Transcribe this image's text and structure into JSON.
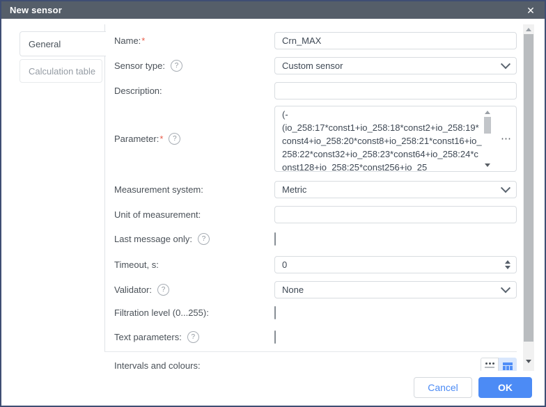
{
  "window": {
    "title": "New sensor"
  },
  "icons": {
    "close": "✕",
    "help": "?",
    "required": "*",
    "param_more": "⋯"
  },
  "tabs": {
    "general": "General",
    "calculation": "Calculation table"
  },
  "form": {
    "name": {
      "label": "Name:",
      "required": true,
      "value": "Crn_MAX"
    },
    "sensor_type": {
      "label": "Sensor type:",
      "value": "Custom sensor"
    },
    "description": {
      "label": "Description:",
      "value": ""
    },
    "parameter": {
      "label": "Parameter:",
      "required": true,
      "value": "(-\n(io_258:17*const1+io_258:18*const2+io_258:19*const4+io_258:20*const8+io_258:21*const16+io_258:22*const32+io_258:23*const64+io_258:24*const128+io_258:25*const256+io_25"
    },
    "measurement_system": {
      "label": "Measurement system:",
      "value": "Metric"
    },
    "unit_of_measurement": {
      "label": "Unit of measurement:",
      "value": ""
    },
    "last_message_only": {
      "label": "Last message only:",
      "checked": false
    },
    "timeout": {
      "label": "Timeout, s:",
      "value": "0"
    },
    "validator": {
      "label": "Validator:",
      "value": "None"
    },
    "filtration_level": {
      "label": "Filtration level (0...255):",
      "checked": false
    },
    "text_parameters": {
      "label": "Text parameters:",
      "checked": false
    },
    "intervals_and_colours": {
      "label": "Intervals and colours:"
    }
  },
  "footer": {
    "cancel": "Cancel",
    "ok": "OK"
  },
  "colors": {
    "accent": "#4c8bf5",
    "titlebar": "#555e69",
    "dialog_border": "#3f4e73",
    "required_marker": "#e85c49"
  }
}
